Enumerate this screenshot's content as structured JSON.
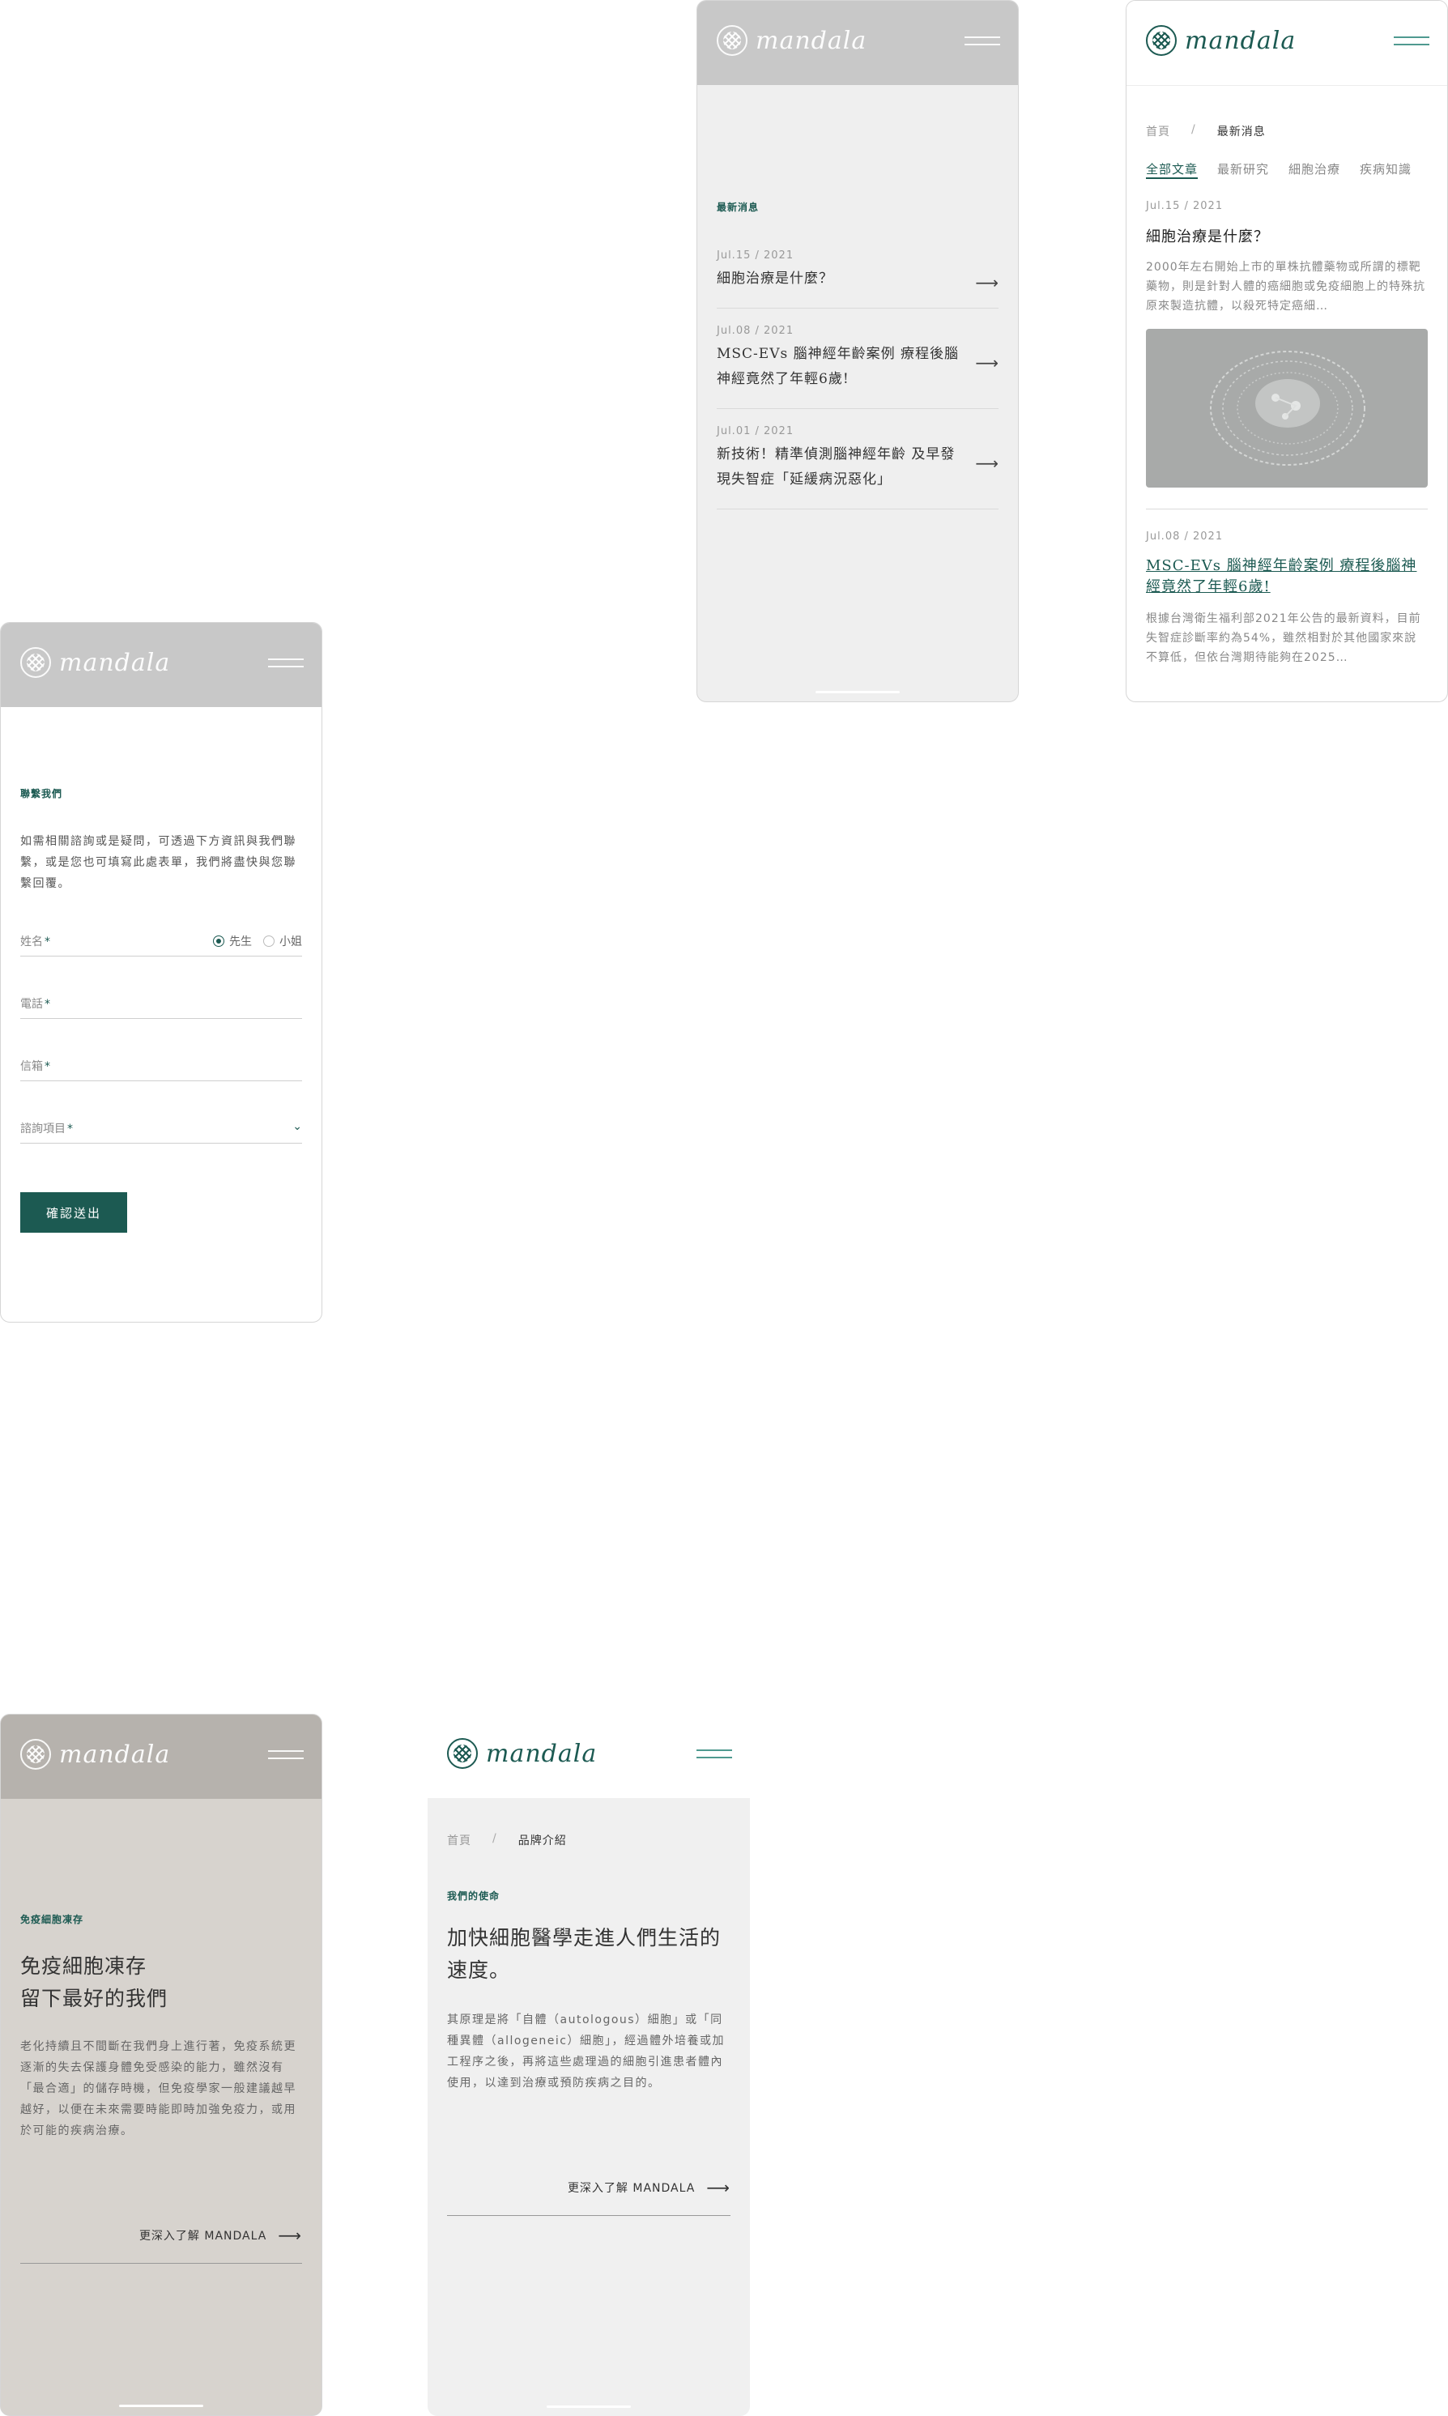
{
  "brand": {
    "logo_text": "mandala",
    "logo_icon": "mandala-logo-icon",
    "menu_icon": "hamburger-icon",
    "accent": "#1c5a52"
  },
  "contact": {
    "section_label": "聯繫我們",
    "intro": "如需相關諮詢或是疑問，可透過下方資訊與我們聯繫，或是您也可填寫此處表單，我們將盡快與您聯繫回覆。",
    "name_label": "姓名",
    "required_mark": "*",
    "gender_options": [
      "先生",
      "小姐"
    ],
    "gender_selected": "先生",
    "phone_label": "電話",
    "email_label": "信箱",
    "inquiry_label": "諮詢項目",
    "submit_label": "確認送出"
  },
  "news_list": {
    "section_label": "最新消息",
    "items": [
      {
        "date": "Jul.15 / 2021",
        "title": "細胞治療是什麼？"
      },
      {
        "date": "Jul.08 / 2021",
        "title": "MSC-EVs 腦神經年齡案例 療程後腦神經竟然了年輕6歲!"
      },
      {
        "date": "Jul.01 / 2021",
        "title": "新技術！精準偵測腦神經年齡 及早發現失智症「延緩病況惡化」"
      }
    ],
    "arrow": "⟶"
  },
  "news_page": {
    "breadcrumb": {
      "home": "首頁",
      "sep": "/",
      "current": "最新消息"
    },
    "tabs": [
      "全部文章",
      "最新研究",
      "細胞治療",
      "疾病知識"
    ],
    "active_tab": "全部文章",
    "articles": [
      {
        "date": "Jul.15 / 2021",
        "title": "細胞治療是什麼？",
        "excerpt": "2000年左右開始上市的單株抗體藥物或所謂的標靶藥物，則是針對人體的癌細胞或免疫細胞上的特殊抗原來製造抗體，以殺死特定癌細…"
      },
      {
        "date": "Jul.08 / 2021",
        "title": "MSC-EVs 腦神經年齡案例 療程後腦神經竟然了年輕6歲!",
        "excerpt": "根據台灣衛生福利部2021年公告的最新資料，目前失智症診斷率約為54%，雖然相對於其他國家來說不算低，但依台灣期待能夠在2025…"
      }
    ]
  },
  "cells": {
    "section_label": "免疫細胞凍存",
    "title_line1": "免疫細胞凍存",
    "title_line2": "留下最好的我們",
    "body": "老化持續且不間斷在我們身上進行著，免疫系統更逐漸的失去保護身體免受感染的能力，雖然沒有「最合適」的儲存時機，但免疫學家一般建議越早越好，以便在未來需要時能即時加強免疫力，或用於可能的疾病治療。",
    "cta": "更深入了解 MANDALA",
    "arrow": "⟶"
  },
  "brand_page": {
    "breadcrumb": {
      "home": "首頁",
      "sep": "/",
      "current": "品牌介紹"
    },
    "section_label": "我們的使命",
    "title": "加快細胞醫學走進人們生活的速度。",
    "body": "其原理是將「自體（autologous）細胞」或「同種異體（allogeneic）細胞」，經過體外培養或加工程序之後，再將這些處理過的細胞引進患者體內使用，以達到治療或預防疾病之目的。",
    "cta": "更深入了解 MANDALA",
    "arrow": "⟶"
  }
}
